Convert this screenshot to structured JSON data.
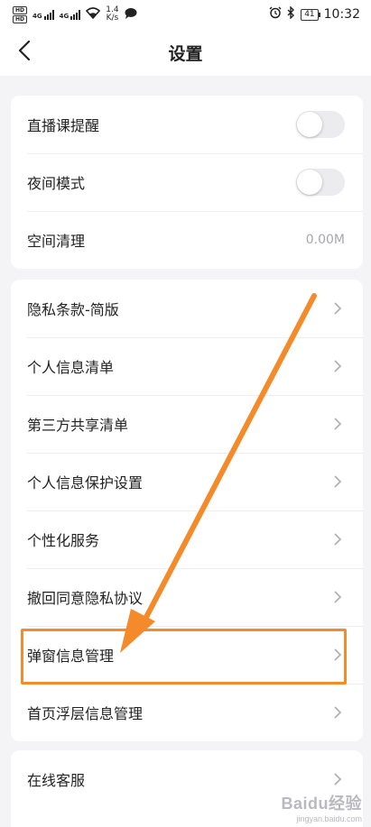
{
  "status_bar": {
    "hd_badges": [
      "HD",
      "HD"
    ],
    "net_labels": [
      "4G",
      "4G"
    ],
    "net_speed_value": "1.4",
    "net_speed_unit": "K/s",
    "battery_level": "41",
    "time": "10:32",
    "icons": [
      "hd-icon",
      "signal-icon",
      "wifi-icon",
      "message-icon",
      "alarm-icon",
      "bluetooth-icon",
      "battery-icon"
    ]
  },
  "nav": {
    "title": "设置",
    "back_icon": "chevron-left-icon"
  },
  "groups": [
    {
      "items": [
        {
          "label": "直播课提醒",
          "control": "toggle",
          "on": false
        },
        {
          "label": "夜间模式",
          "control": "toggle",
          "on": false
        },
        {
          "label": "空间清理",
          "control": "value",
          "value": "0.00M"
        }
      ]
    },
    {
      "items": [
        {
          "label": "隐私条款-简版",
          "control": "chevron"
        },
        {
          "label": "个人信息清单",
          "control": "chevron"
        },
        {
          "label": "第三方共享清单",
          "control": "chevron"
        },
        {
          "label": "个人信息保护设置",
          "control": "chevron"
        },
        {
          "label": "个性化服务",
          "control": "chevron"
        },
        {
          "label": "撤回同意隐私协议",
          "control": "chevron"
        },
        {
          "label": "弹窗信息管理",
          "control": "chevron",
          "highlighted": true
        },
        {
          "label": "首页浮层信息管理",
          "control": "chevron"
        }
      ]
    },
    {
      "items": [
        {
          "label": "在线客服",
          "control": "chevron"
        }
      ]
    }
  ],
  "annotation": {
    "color": "#f58a2a",
    "type": "arrow-and-box"
  },
  "watermark": {
    "logo": "Baidu经验",
    "url": "jingyan.baidu.com"
  },
  "colors": {
    "background": "#f4f4f6",
    "card": "#ffffff",
    "text": "#222222",
    "muted": "#a8a8ad",
    "toggle_off": "#ececee"
  }
}
